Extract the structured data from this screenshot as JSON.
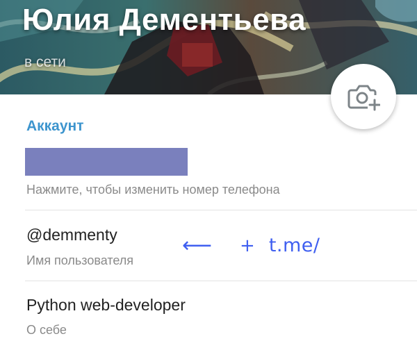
{
  "profile": {
    "name": "Юлия Дементьева",
    "status": "в сети"
  },
  "camera_button": {
    "icon": "camera-add-icon"
  },
  "account": {
    "section_title": "Аккаунт",
    "phone": {
      "value_redacted": true,
      "redaction_color": "#7a80bd",
      "hint": "Нажмите, чтобы изменить номер телефона"
    },
    "username": {
      "value": "@demmenty",
      "hint": "Имя пользователя"
    },
    "bio": {
      "value": "Python web-developer",
      "hint": "О себе"
    }
  },
  "annotation": {
    "arrow": "⟵",
    "plus": "+",
    "text": "t.me/",
    "color": "#3f5ff0"
  },
  "colors": {
    "accent": "#3d95ce",
    "value_text": "#222222",
    "hint_text": "#8a8a8a",
    "divider": "#e3e3e3"
  }
}
